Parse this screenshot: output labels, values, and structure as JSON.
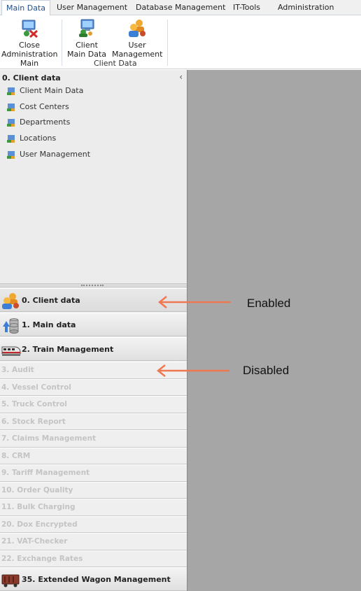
{
  "menu": {
    "tabs": [
      "Main Data",
      "User Management",
      "Database Management",
      "IT-Tools",
      "Administration"
    ],
    "active_index": 0
  },
  "ribbon": {
    "buttons": [
      {
        "line1": "Close",
        "line2": "Administration",
        "line3": "Main",
        "icon": "close-admin-icon"
      },
      {
        "line1": "Client",
        "line2": "Main Data",
        "icon": "client-main-data-icon"
      },
      {
        "line1": "User",
        "line2": "Management",
        "icon": "user-management-icon"
      }
    ],
    "group_label": "Client Data"
  },
  "tree": {
    "title": "0. Client data",
    "collapse_glyph": "‹",
    "items": [
      "Client Main Data",
      "Cost Centers",
      "Departments",
      "Locations",
      "User Management"
    ]
  },
  "nav": {
    "enabled": [
      {
        "label": "0. Client data",
        "icon": "client-data-icon"
      },
      {
        "label": "1. Main data",
        "icon": "main-data-icon"
      },
      {
        "label": "2. Train Management",
        "icon": "train-icon"
      }
    ],
    "disabled": [
      "3. Audit",
      "4. Vessel Control",
      "5. Truck Control",
      "6. Stock Report",
      "7. Claims Management",
      "8. CRM",
      "9. Tariff Management",
      "10. Order Quality",
      "11. Bulk Charging",
      "20. Dox Encrypted",
      "21. VAT-Checker",
      "22. Exchange Rates"
    ],
    "last": {
      "label": "35. Extended Wagon Management",
      "icon": "wagon-icon"
    }
  },
  "annotations": {
    "enabled": "Enabled",
    "disabled": "Disabled",
    "arrow_color": "#f07850"
  },
  "colors": {
    "workspace": "#a6a6a6",
    "panel": "#ececec",
    "disabled_text": "#c4c4c4",
    "active_tab_text": "#1f4f8f"
  }
}
